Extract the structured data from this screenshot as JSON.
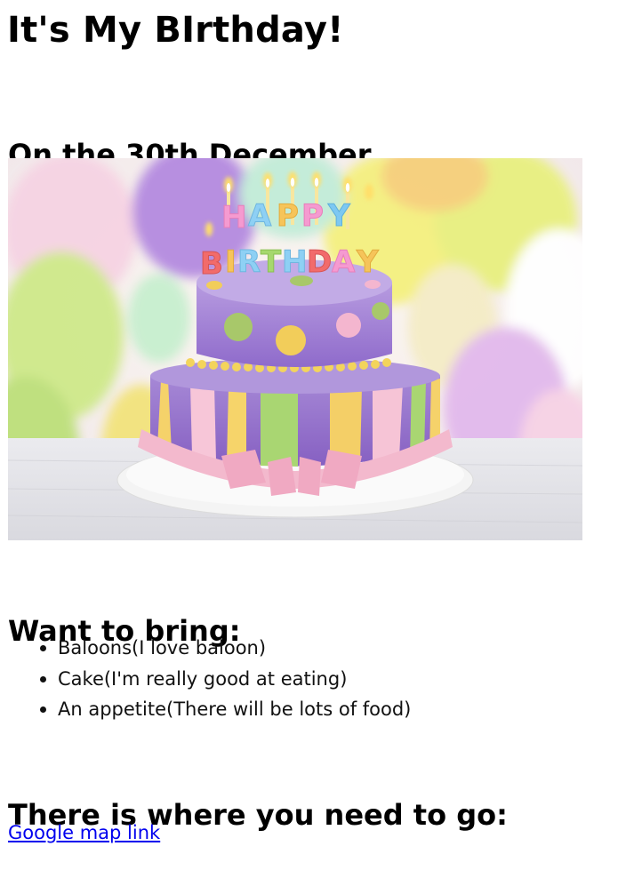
{
  "page": {
    "title": "It's My BIrthday!",
    "date_heading": "On the 30th December"
  },
  "hero_image": {
    "description_icon": "birthday-cake-image",
    "candle_text_line1": "HAPPY",
    "candle_text_line2": "BIRTHDAY"
  },
  "bring": {
    "heading": "Want to bring:",
    "items": [
      "Baloons(I love baloon)",
      "Cake(I'm really good at eating)",
      "An appetite(There will be lots of food)"
    ]
  },
  "directions": {
    "heading": "There is where you need to go:",
    "link_text": "Google map link"
  },
  "colors": {
    "link": "#0000ee",
    "text": "#000000",
    "background": "#ffffff"
  }
}
